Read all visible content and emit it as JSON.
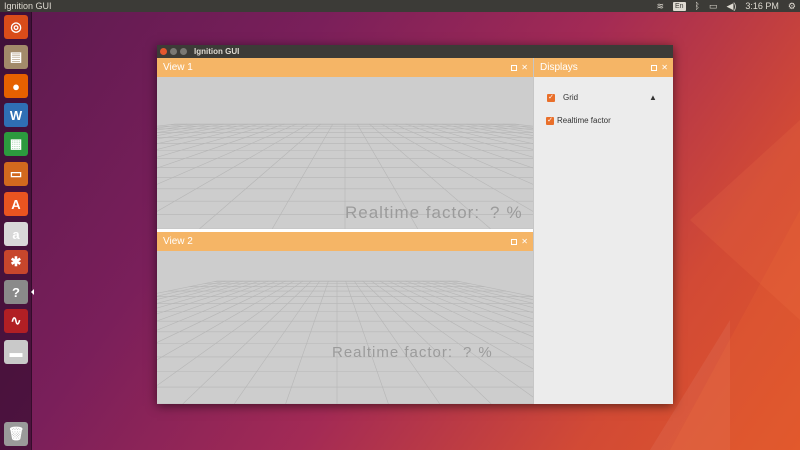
{
  "top_panel": {
    "app_title": "Ignition GUI",
    "keyboard_layout": "En",
    "clock": "3:16 PM",
    "tray_icons": [
      "wifi-icon",
      "keyboard-layout-indicator",
      "bluetooth-icon",
      "battery-icon",
      "volume-icon",
      "gear-icon"
    ]
  },
  "launcher": {
    "items": [
      {
        "name": "ubuntu-dash-icon",
        "glyph": "◎",
        "color": "#d94c1a"
      },
      {
        "name": "files-icon",
        "glyph": "▤",
        "color": "#a28a6a"
      },
      {
        "name": "firefox-icon",
        "glyph": "●",
        "color": "#e66000"
      },
      {
        "name": "writer-icon",
        "glyph": "W",
        "color": "#2f6fb4"
      },
      {
        "name": "calc-icon",
        "glyph": "▦",
        "color": "#2c9a3e"
      },
      {
        "name": "impress-icon",
        "glyph": "▭",
        "color": "#d2691e"
      },
      {
        "name": "software-center-icon",
        "glyph": "A",
        "color": "#e95420"
      },
      {
        "name": "amazon-icon",
        "glyph": "a",
        "color": "#d8d8d8"
      },
      {
        "name": "settings-icon",
        "glyph": "✱",
        "color": "#c7462c"
      },
      {
        "name": "unknown-app-icon",
        "glyph": "?",
        "color": "#8a8a8a"
      },
      {
        "name": "system-monitor-icon",
        "glyph": "∿",
        "color": "#b11f24"
      },
      {
        "name": "drive-icon",
        "glyph": "▬",
        "color": "#c9c9c9"
      },
      {
        "name": "trash-icon",
        "glyph": "🗑",
        "color": "#9a9a9a"
      }
    ]
  },
  "window": {
    "title": "Ignition GUI",
    "view1": {
      "title": "View 1",
      "overlay_label": "Realtime  factor:",
      "overlay_value": "?",
      "overlay_unit": "%"
    },
    "view2": {
      "title": "View 2",
      "overlay_label": "Realtime  factor:",
      "overlay_value": "?",
      "overlay_unit": "%"
    },
    "displays": {
      "title": "Displays",
      "items": [
        {
          "label": "Grid",
          "checked": true
        },
        {
          "label": "Realtime factor",
          "checked": true
        }
      ]
    },
    "panel_buttons": {
      "float": "◻",
      "close": "✕"
    }
  },
  "colors": {
    "panel_header": "#f5b566",
    "checkbox": "#e96f2a",
    "viewport_bg": "#cdcdcd",
    "grid_line": "#b6b6b6"
  }
}
